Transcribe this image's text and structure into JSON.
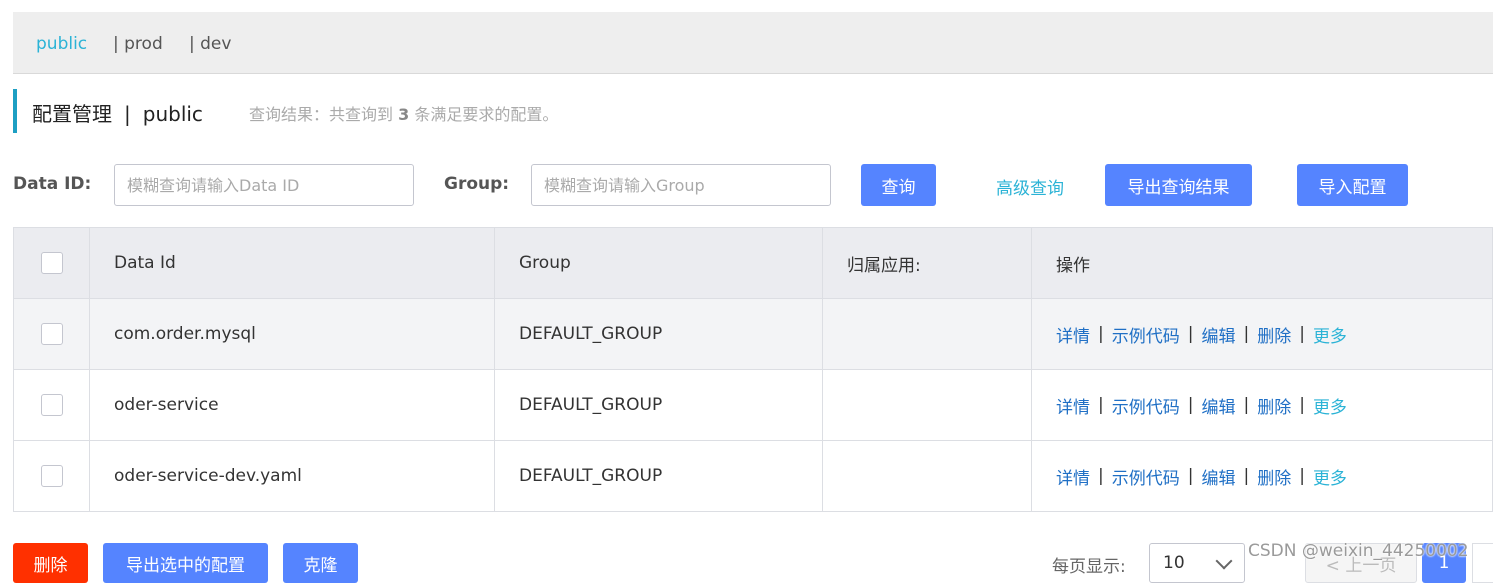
{
  "namespace_tabs": [
    {
      "label": "public",
      "active": true
    },
    {
      "label": "| prod",
      "active": false
    },
    {
      "label": "| dev",
      "active": false
    }
  ],
  "header": {
    "title": "配置管理",
    "separator": "|",
    "namespace": "public",
    "result_prefix": "查询结果：共查询到",
    "result_count": "3",
    "result_suffix": "条满足要求的配置。"
  },
  "filters": {
    "data_id_label": "Data ID:",
    "data_id_placeholder": "模糊查询请输入Data ID",
    "data_id_value": "",
    "group_label": "Group:",
    "group_placeholder": "模糊查询请输入Group",
    "group_value": "",
    "search_button": "查询",
    "advanced_query": "高级查询",
    "export_results_button": "导出查询结果",
    "import_config_button": "导入配置"
  },
  "table": {
    "columns": [
      "Data Id",
      "Group",
      "归属应用:",
      "操作"
    ],
    "rows": [
      {
        "data_id": "com.order.mysql",
        "group": "DEFAULT_GROUP",
        "app": "",
        "checked": false
      },
      {
        "data_id": "oder-service",
        "group": "DEFAULT_GROUP",
        "app": "",
        "checked": false
      },
      {
        "data_id": "oder-service-dev.yaml",
        "group": "DEFAULT_GROUP",
        "app": "",
        "checked": false
      }
    ],
    "actions": {
      "details": "详情",
      "sample_code": "示例代码",
      "edit": "编辑",
      "delete": "删除",
      "more": "更多",
      "separator": "|"
    }
  },
  "bottom_actions": {
    "delete": "删除",
    "export_selected": "导出选中的配置",
    "clone": "克隆"
  },
  "pagination": {
    "page_size_label": "每页显示:",
    "page_size": "10",
    "prev": "< 上一页",
    "current_page": "1"
  },
  "watermark": "CSDN @weixin_44250002",
  "colors": {
    "accent": "#5584ff",
    "link": "#1f6fc5",
    "cyan": "#2bb3d6",
    "danger": "#ff3000"
  }
}
